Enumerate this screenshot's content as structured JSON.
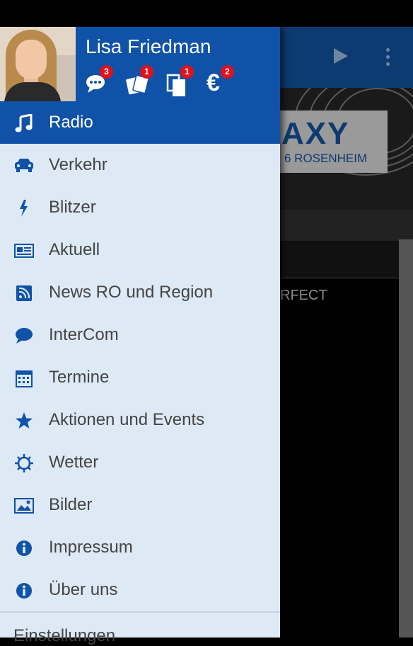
{
  "user": {
    "name": "Lisa Friedman",
    "badges": [
      {
        "icon": "chat-icon",
        "count": "3"
      },
      {
        "icon": "tickets-icon",
        "count": "1"
      },
      {
        "icon": "documents-icon",
        "count": "1"
      },
      {
        "icon": "euro-icon",
        "count": "2"
      }
    ]
  },
  "menu": [
    {
      "label": "Radio",
      "icon": "music-note-icon",
      "active": true
    },
    {
      "label": "Verkehr",
      "icon": "car-icon"
    },
    {
      "label": "Blitzer",
      "icon": "lightning-icon"
    },
    {
      "label": "Aktuell",
      "icon": "newspaper-icon"
    },
    {
      "label": "News RO und Region",
      "icon": "rss-icon"
    },
    {
      "label": "InterCom",
      "icon": "speech-bubble-icon"
    },
    {
      "label": "Termine",
      "icon": "calendar-icon"
    },
    {
      "label": "Aktionen und Events",
      "icon": "star-icon"
    },
    {
      "label": "Wetter",
      "icon": "sun-icon"
    },
    {
      "label": "Bilder",
      "icon": "image-icon"
    },
    {
      "label": "Impressum",
      "icon": "info-icon"
    },
    {
      "label": "Über uns",
      "icon": "info-icon"
    }
  ],
  "settings_label": "Einstellungen",
  "background": {
    "logo_big": "AXY",
    "logo_small": "6 ROSENHEIM",
    "now_playing": "RFECT"
  },
  "colors": {
    "accent": "#1052a8",
    "drawer_bg": "#dde9f5",
    "badge": "#e0121b"
  }
}
